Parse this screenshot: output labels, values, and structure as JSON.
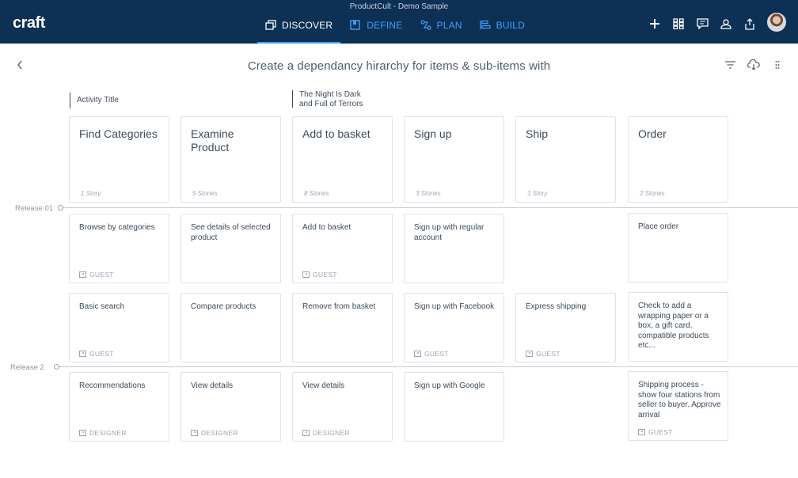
{
  "app": {
    "title": "ProductCult - Demo Sample",
    "logo": "craft"
  },
  "nav": [
    {
      "label": "DISCOVER",
      "icon": "copy-icon",
      "active": true
    },
    {
      "label": "DEFINE",
      "icon": "book-icon",
      "active": false
    },
    {
      "label": "PLAN",
      "icon": "plan-icon",
      "active": false
    },
    {
      "label": "BUILD",
      "icon": "build-icon",
      "active": false
    }
  ],
  "toolbar": {
    "title": "Create a dependancy hirarchy for items & sub-items with"
  },
  "column_headers": {
    "activity": "Activity Title",
    "night_line1": "The Night Is Dark",
    "night_line2": "and Full of Terrors"
  },
  "epics": [
    {
      "title": "Find Categories",
      "count": "1 Story"
    },
    {
      "title": "Examine Product",
      "count": "5 Stories"
    },
    {
      "title": "Add to basket",
      "count": "8 Stories"
    },
    {
      "title": "Sign up",
      "count": "3 Stories"
    },
    {
      "title": "Ship",
      "count": "1 Story"
    },
    {
      "title": "Order",
      "count": "2 Stories"
    }
  ],
  "releases": [
    {
      "label": "Release 01"
    },
    {
      "label": "Release 2"
    }
  ],
  "stories": {
    "r1": [
      {
        "text": "Browse by categories",
        "persona": "GUEST"
      },
      {
        "text": "See details of selected product",
        "persona": ""
      },
      {
        "text": "Add to basket",
        "persona": "GUEST"
      },
      {
        "text": "Sign up with regular account",
        "persona": ""
      },
      null,
      {
        "text": "Place order",
        "persona": ""
      }
    ],
    "r1b": [
      {
        "text": "Basic search",
        "persona": "GUEST"
      },
      {
        "text": "Compare products",
        "persona": ""
      },
      {
        "text": "Remove from basket",
        "persona": ""
      },
      {
        "text": "Sign up with Facebook",
        "persona": "GUEST"
      },
      {
        "text": "Express shipping",
        "persona": "GUEST"
      },
      {
        "text": "Check to add a wrapping paper or a box, a gift card, compatible products etc...",
        "persona": ""
      }
    ],
    "r2": [
      {
        "text": "Recommendations",
        "persona": "DESIGNER"
      },
      {
        "text": "View details",
        "persona": "DESIGNER"
      },
      {
        "text": "View details",
        "persona": "DESIGNER"
      },
      {
        "text": "Sign up with Google",
        "persona": ""
      },
      null,
      {
        "text": "Shipping process - show four stations from seller to buyer. Approve arrival",
        "persona": "GUEST"
      }
    ]
  },
  "colors": {
    "topbar": "#0d3055",
    "accent": "#3ea1ff",
    "text": "#3d4b59",
    "muted": "#9aa5b1"
  }
}
